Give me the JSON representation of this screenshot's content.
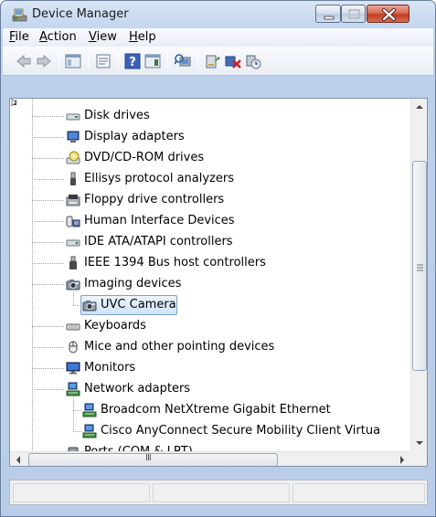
{
  "window": {
    "title": "Device Manager"
  },
  "menu": [
    {
      "label": "File",
      "mnemonic": "F"
    },
    {
      "label": "Action",
      "mnemonic": "A"
    },
    {
      "label": "View",
      "mnemonic": "V"
    },
    {
      "label": "Help",
      "mnemonic": "H"
    }
  ],
  "toolbar_icons": [
    "back-arrow-icon",
    "forward-arrow-icon",
    "show-hide-console-tree-icon",
    "properties-icon",
    "help-icon",
    "action-pane-icon",
    "scan-hardware-changes-icon",
    "update-driver-icon",
    "uninstall-device-icon",
    "enable-device-icon"
  ],
  "tree": {
    "items": [
      {
        "label": "Disk drives",
        "icon": "disk-drive-icon",
        "expanded": false
      },
      {
        "label": "Display adapters",
        "icon": "display-adapter-icon",
        "expanded": false
      },
      {
        "label": "DVD/CD-ROM drives",
        "icon": "dvd-drive-icon",
        "expanded": false
      },
      {
        "label": "Ellisys protocol analyzers",
        "icon": "usb-plug-icon",
        "expanded": false
      },
      {
        "label": "Floppy drive controllers",
        "icon": "floppy-controller-icon",
        "expanded": false
      },
      {
        "label": "Human Interface Devices",
        "icon": "hid-icon",
        "expanded": false
      },
      {
        "label": "IDE ATA/ATAPI controllers",
        "icon": "ide-controller-icon",
        "expanded": false
      },
      {
        "label": "IEEE 1394 Bus host controllers",
        "icon": "firewire-icon",
        "expanded": false
      },
      {
        "label": "Imaging devices",
        "icon": "camera-icon",
        "expanded": true
      },
      {
        "label": "UVC Camera",
        "icon": "camera-icon",
        "child": true,
        "selected": true
      },
      {
        "label": "Keyboards",
        "icon": "keyboard-icon",
        "expanded": false
      },
      {
        "label": "Mice and other pointing devices",
        "icon": "mouse-icon",
        "expanded": false
      },
      {
        "label": "Monitors",
        "icon": "monitor-icon",
        "expanded": false
      },
      {
        "label": "Network adapters",
        "icon": "network-adapter-icon",
        "expanded": true
      },
      {
        "label": "Broadcom NetXtreme Gigabit Ethernet",
        "icon": "network-adapter-icon",
        "child": true
      },
      {
        "label": "Cisco AnyConnect Secure Mobility Client Virtua",
        "icon": "network-adapter-icon",
        "child": true
      },
      {
        "label": "Ports (COM & LPT)",
        "icon": "port-icon",
        "expanded": false
      }
    ]
  },
  "scrollbar": {
    "h_thumb_grip": "III"
  },
  "colors": {
    "selection_border": "#7da2ce",
    "close_button": "#c94a33"
  }
}
